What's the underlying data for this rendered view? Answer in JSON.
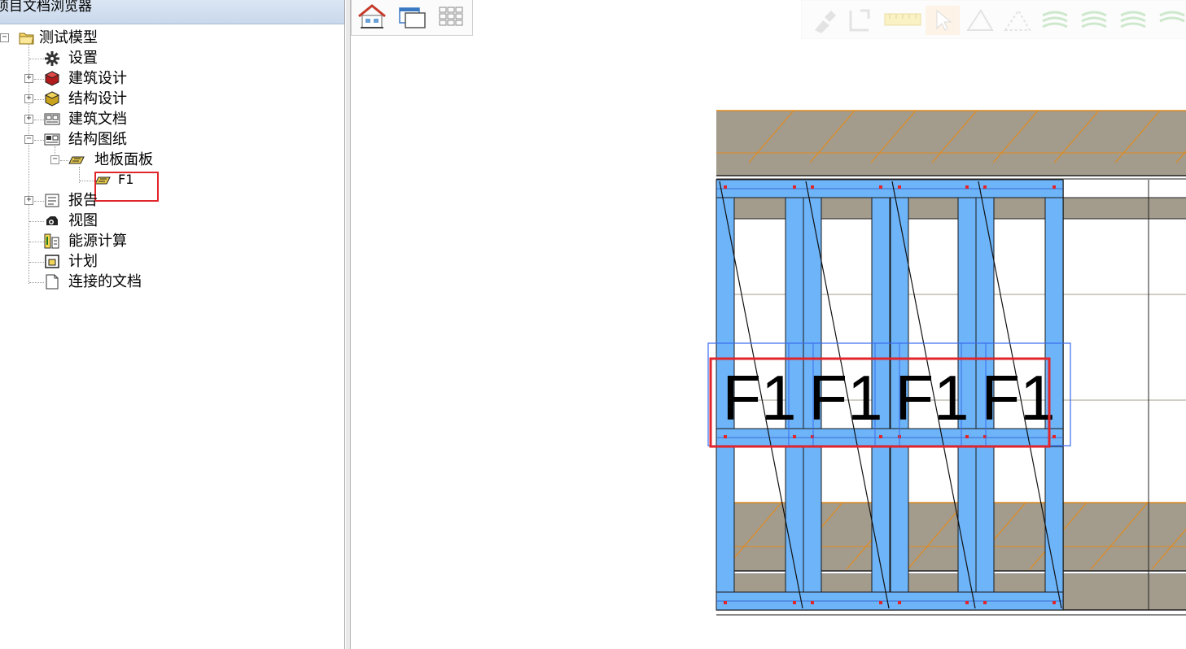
{
  "panel": {
    "title": "项目文档浏览器"
  },
  "tree": {
    "root": {
      "label": "测试模型",
      "icon": "folder-open-icon"
    },
    "items": [
      {
        "label": "设置",
        "icon": "gear-icon"
      },
      {
        "label": "建筑设计",
        "icon": "red-cube-icon"
      },
      {
        "label": "结构设计",
        "icon": "yellow-cube-icon"
      },
      {
        "label": "建筑文档",
        "icon": "architecture-doc-icon"
      },
      {
        "label": "结构图纸",
        "icon": "structure-drawing-icon"
      },
      {
        "label": "地板面板",
        "icon": "floor-panel-icon"
      },
      {
        "label": "F1",
        "icon": "floor-panel-icon"
      },
      {
        "label": "报告",
        "icon": "report-icon"
      },
      {
        "label": "视图",
        "icon": "camera-icon"
      },
      {
        "label": "能源计算",
        "icon": "energy-calc-icon"
      },
      {
        "label": "计划",
        "icon": "plan-icon"
      },
      {
        "label": "连接的文档",
        "icon": "document-icon"
      }
    ]
  },
  "toolbar": {
    "home": "home-icon",
    "windows": "windows-icon",
    "grid": "grid-icon"
  },
  "drawing": {
    "panel_labels": [
      "F1",
      "F1",
      "F1",
      "F1"
    ],
    "colors": {
      "stud": "#6db4f8",
      "wall": "#a39c8d",
      "hatch": "#e08a1e",
      "highlight": "#e0262b",
      "selection": "#3a6cf0"
    }
  }
}
